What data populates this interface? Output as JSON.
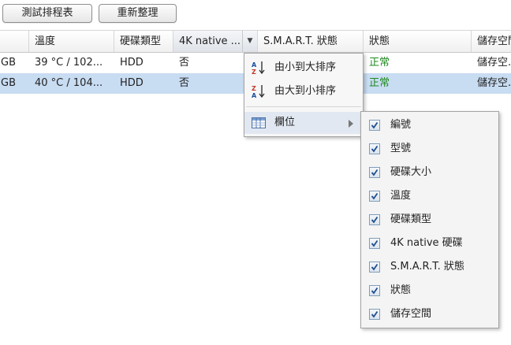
{
  "toolbar": {
    "test_schedule_label": "測試排程表",
    "refresh_label": "重新整理"
  },
  "table": {
    "columns": [
      {
        "label": ""
      },
      {
        "label": "溫度"
      },
      {
        "label": "硬碟類型"
      },
      {
        "label": "4K native ..."
      },
      {
        "label": "S.M.A.R.T. 狀態"
      },
      {
        "label": "狀態"
      },
      {
        "label": "儲存空間"
      }
    ],
    "rows": [
      {
        "size": "GB",
        "temp": "39 °C / 102...",
        "type": "HDD",
        "native4k": "否",
        "smart": "",
        "status": "正常",
        "storage": "儲存空..."
      },
      {
        "size": "GB",
        "temp": "40 °C / 104...",
        "type": "HDD",
        "native4k": "否",
        "smart": "",
        "status": "正常",
        "storage": "儲存空..."
      }
    ],
    "selected_row": 1
  },
  "sort_menu": {
    "asc_label": "由小到大排序",
    "desc_label": "由大到小排序",
    "columns_label": "欄位"
  },
  "columns_menu": {
    "items": [
      {
        "label": "編號",
        "checked": true
      },
      {
        "label": "型號",
        "checked": true
      },
      {
        "label": "硬碟大小",
        "checked": true
      },
      {
        "label": "溫度",
        "checked": true
      },
      {
        "label": "硬碟類型",
        "checked": true
      },
      {
        "label": "4K native 硬碟",
        "checked": true
      },
      {
        "label": "S.M.A.R.T. 狀態",
        "checked": true
      },
      {
        "label": "狀態",
        "checked": true
      },
      {
        "label": "儲存空間",
        "checked": true
      }
    ]
  },
  "colors": {
    "selected_row": "#c8dcf2",
    "status_ok": "#1e8a1e",
    "checkbox_border": "#7f9db9",
    "checkmark": "#1f4f8f"
  }
}
